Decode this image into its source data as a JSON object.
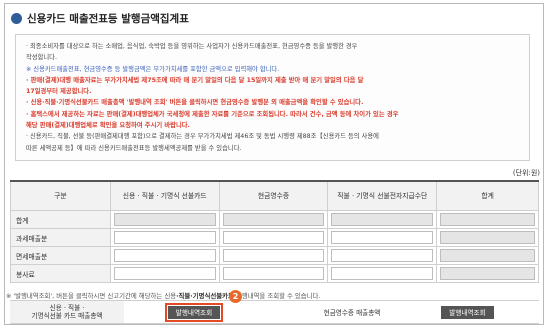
{
  "header": {
    "title": "신용카드 매출전표등 발행금액집계표"
  },
  "notice": [
    {
      "style": "normal",
      "text": "· 최종소비자를 대상으로 하는 소매업, 음식업, 숙박업 등을 영위하는 사업자가 신용카드매출전표, 현금영수증 등을 발행한 경우"
    },
    {
      "style": "normal",
      "text": "  작성합니다."
    },
    {
      "style": "blue",
      "text": "※ 신용카드매출전표, 현금영수증 등 발행금액은 부가가치세를 포함한 금액으로 입력해야 합니다."
    },
    {
      "style": "red",
      "text": "· 판매(결제)대행 매출자료는 부가가치세법 제75조에 따라 매 분기 말일의 다음 달 15일까지 제출 받아 매 분기 말일의 다음 달"
    },
    {
      "style": "red",
      "text": "  17일경부터 제공합니다."
    },
    {
      "style": "red",
      "text": "· 신용·직불·기명식선불카드 매출총액 '발행내역 조회' 버튼을 클릭하시면 현금영수증 발행분 외 매출금액을 확인할 수 있습니다."
    },
    {
      "style": "red",
      "text": "· 홈택스에서 제공하는 자료는 판매(결제)대행업체가 국세청에 제출한 자료를 기준으로 조회됩니다. 따라서 건수, 금액 등에 차이가 있는 경우"
    },
    {
      "style": "red",
      "text": "  해당 판매(결제)대행업체로 확인을 요청하여 주시기 바랍니다."
    },
    {
      "style": "normal",
      "text": "· 신용카드, 직불, 선불 등(판매결제대행 포함)으로 결제하는 경우 부가가치세법 제46조 및 동법 시행령 제88조【신용카드 등의 사용에"
    },
    {
      "style": "normal",
      "text": "  따른 세액공제 등】에 따라 신용카드매출전표등 발행세액공제를 받을 수 있습니다."
    }
  ],
  "unit": "(단위:원)",
  "table": {
    "headers": [
      "구분",
      "신용 · 직불 · 기명식 선불카드",
      "현금영수증",
      "직불 · 기명식 선불전자지급수단",
      "합계"
    ],
    "rows": [
      "합계",
      "과세매출분",
      "면세매출분",
      "봉사료"
    ]
  },
  "footer": {
    "note_prefix": "※ '발행내역조회', 버튼을 클릭하시면 신고기간에 해당하는 신용",
    "note_bold": "·직불·기명식선불카드",
    "note_suffix": " 발행내역을 조회할 수 있습니다.",
    "card_label_line1": "신용 · 직불 ·",
    "card_label_line2": "기명식선불 카드 매출총액",
    "card_button": "발행내역조회",
    "badge": "2",
    "cash_label": "현금영수증 매출총액",
    "cash_button": "발행내역조회"
  }
}
